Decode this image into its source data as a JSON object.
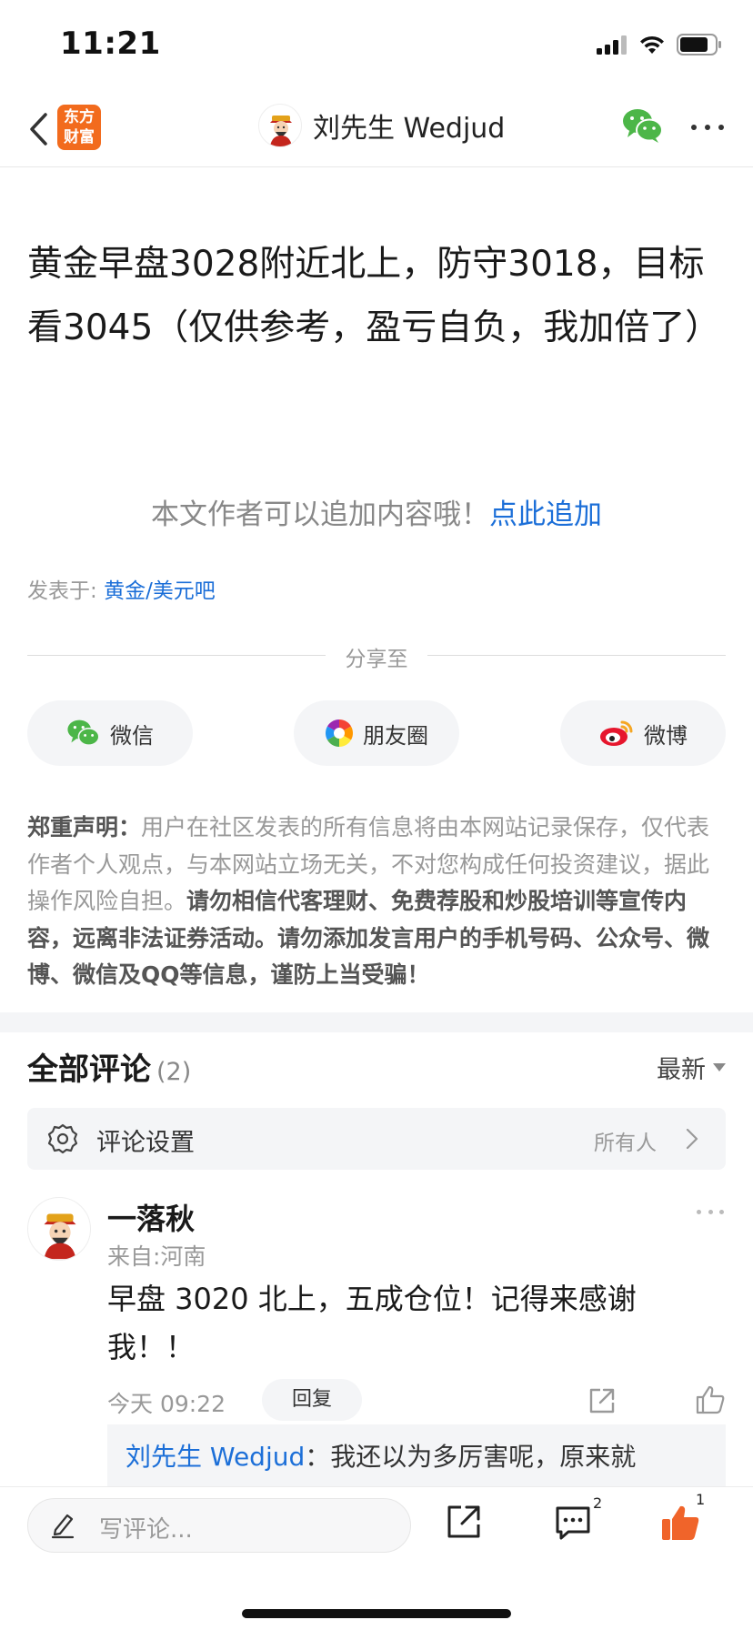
{
  "status_bar": {
    "time": "11:21"
  },
  "nav": {
    "app_logo_line1": "东方",
    "app_logo_line2": "财富",
    "author_name": "刘先生 Wedjud"
  },
  "post": {
    "text": "黄金早盘3028附近北上，防守3018，目标看3045（仅供参考，盈亏自负，我加倍了）",
    "append_hint": "本文作者可以追加内容哦！",
    "append_link": "点此追加",
    "posted_in_label": "发表于: ",
    "posted_in_forum": "黄金/美元吧"
  },
  "share": {
    "label": "分享至",
    "wechat": "微信",
    "moments": "朋友圈",
    "weibo": "微博"
  },
  "disclaimer": {
    "title": "郑重声明：",
    "body": "用户在社区发表的所有信息将由本网站记录保存，仅代表作者个人观点，与本网站立场无关，不对您构成任何投资建议，据此操作风险自担。",
    "warning": "请勿相信代客理财、免费荐股和炒股培训等宣传内容，远离非法证券活动。请勿添加发言用户的手机号码、公众号、微博、微信及QQ等信息，谨防上当受骗！"
  },
  "comments": {
    "title": "全部评论",
    "count": "(2)",
    "sort": "最新",
    "settings_label": "评论设置",
    "settings_value": "所有人",
    "items": [
      {
        "name": "一落秋",
        "from": "来自:河南",
        "text": "早盘 3020 北上，五成仓位！记得来感谢我！！",
        "time": "今天 09:22",
        "reply_label": "回复",
        "reply_preview_name": "刘先生 Wedjud",
        "reply_preview_text": "：我还以为多厉害呢，原来就"
      }
    ]
  },
  "bottom_bar": {
    "placeholder": "写评论...",
    "comment_count": "2",
    "like_count": "1"
  },
  "colors": {
    "link": "#1c6fd8",
    "brand": "#f26b1d",
    "like": "#f0642a",
    "wechat": "#4cb648"
  }
}
